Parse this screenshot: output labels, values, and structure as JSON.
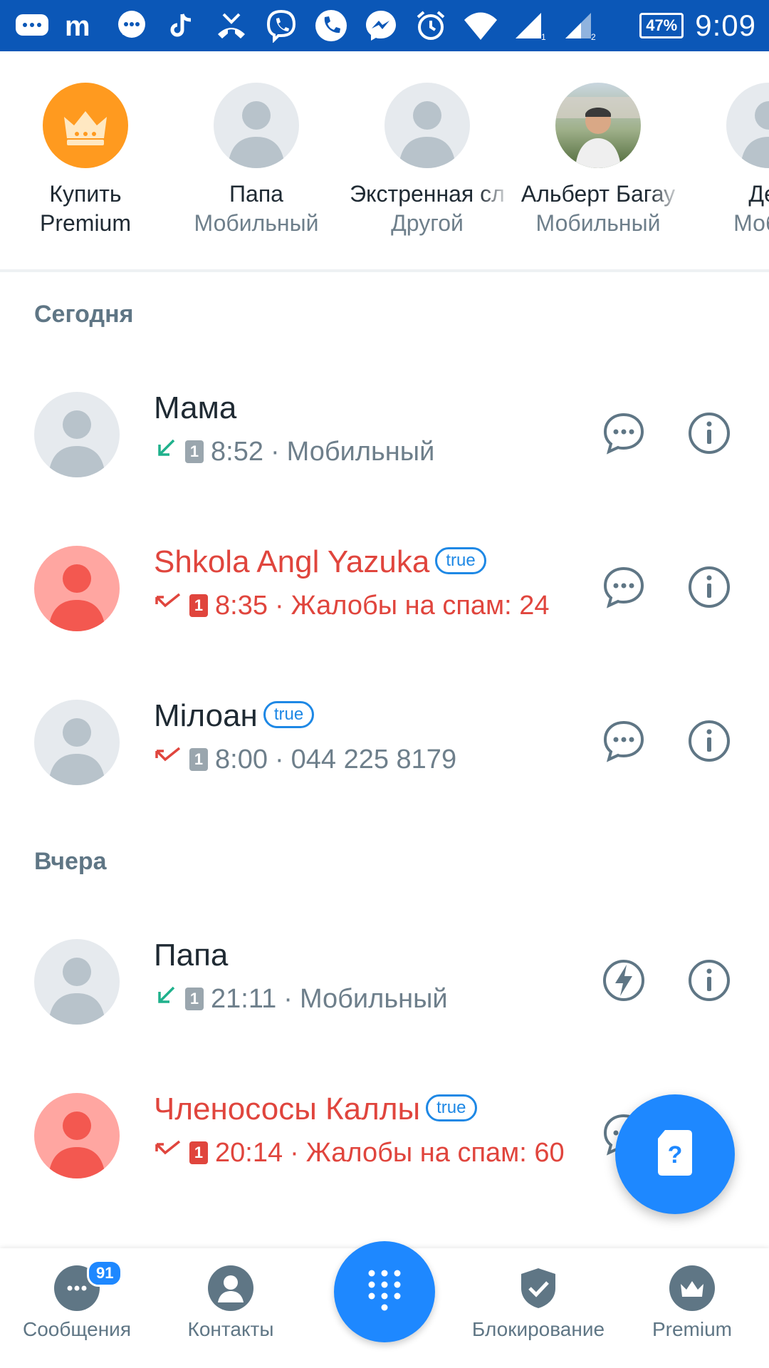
{
  "status_bar": {
    "battery": "47%",
    "time": "9:09"
  },
  "favorites": [
    {
      "name": "Купить",
      "sub": "Premium",
      "avatar": "crown"
    },
    {
      "name": "Папа",
      "sub": "Мобильный",
      "avatar": "person"
    },
    {
      "name": "Экстренная сл",
      "sub": "Другой",
      "avatar": "person"
    },
    {
      "name": "Альберт Багау",
      "sub": "Мобильный",
      "avatar": "photo"
    },
    {
      "name": "Ден",
      "sub": "Мобил",
      "avatar": "person"
    }
  ],
  "sections": {
    "today": "Сегодня",
    "yesterday": "Вчера"
  },
  "calls": [
    {
      "name": "Мама",
      "tag": "",
      "time": "8:52",
      "detail": "Мобильный",
      "type": "incoming",
      "sim": "1",
      "spam": false,
      "action": "message"
    },
    {
      "name": "Shkola Angl Yazuka",
      "tag": "true",
      "time": "8:35",
      "detail": "Жалобы на спам: 24",
      "type": "missed",
      "sim": "1",
      "spam": true,
      "action": "message"
    },
    {
      "name": "Мiлоан",
      "tag": "true",
      "time": "8:00",
      "detail": "044 225 8179",
      "type": "missed",
      "sim": "1",
      "spam": false,
      "action": "message"
    },
    {
      "name": "Папа",
      "tag": "",
      "time": "21:11",
      "detail": "Мобильный",
      "type": "incoming",
      "sim": "1",
      "spam": false,
      "action": "flash"
    },
    {
      "name": "Членососы Каллы",
      "tag": "true",
      "time": "20:14",
      "detail": "Жалобы на спам: 60",
      "type": "missed",
      "sim": "1",
      "spam": true,
      "action": "message"
    }
  ],
  "bottom_nav": {
    "messages": "Сообщения",
    "messages_badge": "91",
    "contacts": "Контакты",
    "blocking": "Блокирование",
    "premium": "Premium"
  },
  "fab_icon": "question-sim-icon",
  "colors": {
    "status_bar": "#0b57b7",
    "accent": "#1e88ff",
    "spam": "#e0453d",
    "secondary_text": "#6e7f8b",
    "section_title": "#5f7685"
  }
}
